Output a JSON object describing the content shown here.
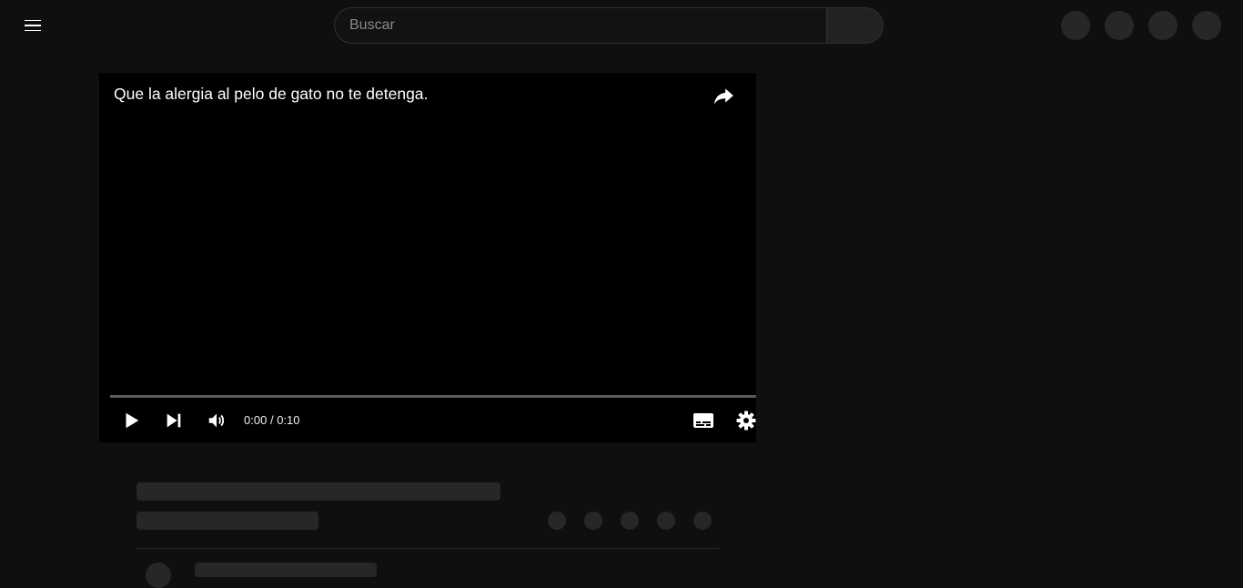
{
  "header": {
    "search_placeholder": "Buscar"
  },
  "player": {
    "title": "Que la alergia al pelo de gato no te detenga.",
    "time_current": "0:00",
    "time_separator": "/",
    "time_total": "0:10",
    "progress_fraction": 0
  },
  "icons": {
    "menu": "menu-icon",
    "share": "share-icon",
    "play": "play-icon",
    "next": "skip-next-icon",
    "volume": "volume-icon",
    "subtitles": "subtitles-icon",
    "settings": "gear-icon"
  },
  "colors": {
    "background": "#0f0f0f",
    "player_bg": "#000000",
    "placeholder_skeleton": "#272727"
  }
}
